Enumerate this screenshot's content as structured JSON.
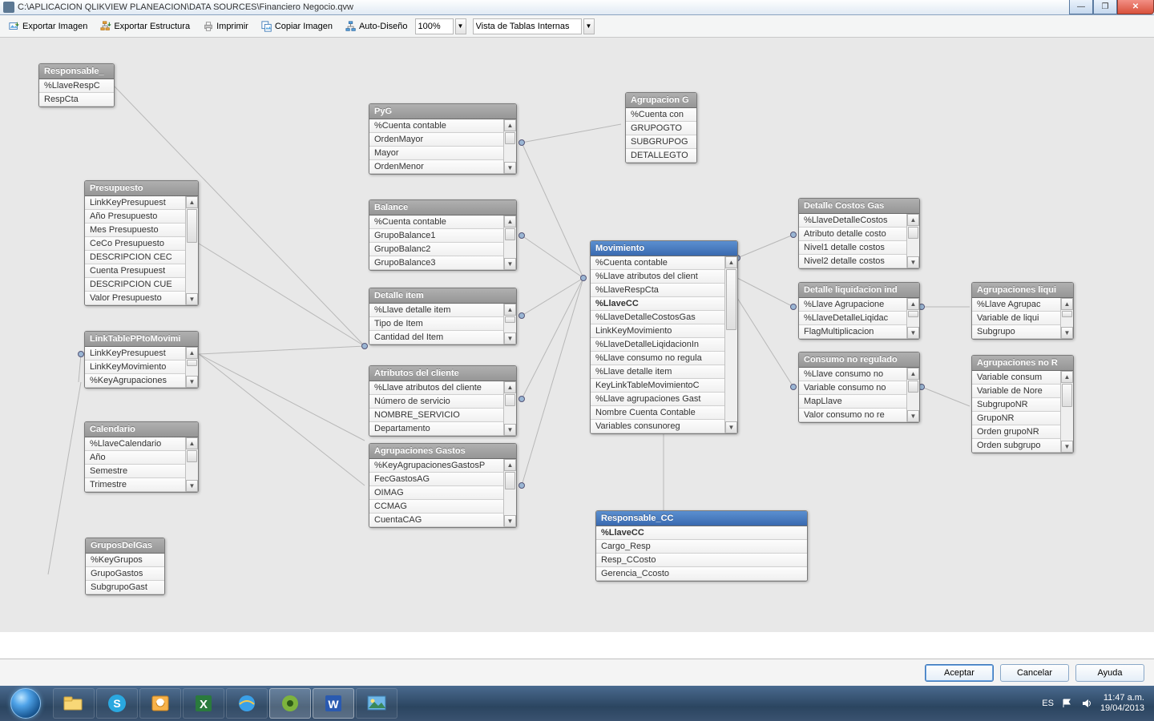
{
  "title": "C:\\APLICACION QLIKVIEW PLANEACION\\DATA SOURCES\\Financiero Negocio.qvw",
  "window_buttons": {
    "min": "—",
    "max": "❐",
    "close": "✕"
  },
  "toolbar": {
    "export_image": "Exportar Imagen",
    "export_struct": "Exportar Estructura",
    "print": "Imprimir",
    "copy_image": "Copiar Imagen",
    "auto_design": "Auto-Diseño",
    "zoom": "100%",
    "view_tables": "Vista de Tablas Internas"
  },
  "tables": {
    "responsable": {
      "title": "Responsable_",
      "rows": [
        "%LlaveRespC",
        "RespCta"
      ],
      "scroll": false
    },
    "presupuesto": {
      "title": "Presupuesto",
      "rows": [
        "LinkKeyPresupuest",
        "Año Presupuesto",
        "Mes Presupuesto",
        "CeCo Presupuesto",
        "DESCRIPCION CEC",
        "Cuenta Presupuest",
        "DESCRIPCION CUE",
        "Valor Presupuesto"
      ],
      "scroll": true
    },
    "linktable": {
      "title": "LinkTablePPtoMovimi",
      "rows": [
        "LinkKeyPresupuest",
        "LinkKeyMovimiento",
        "%KeyAgrupaciones"
      ],
      "scroll": true
    },
    "calendario": {
      "title": "Calendario",
      "rows": [
        "%LlaveCalendario",
        "Año",
        "Semestre",
        "Trimestre"
      ],
      "scroll": true
    },
    "gruposgas": {
      "title": "GruposDelGas",
      "rows": [
        "%KeyGrupos",
        "GrupoGastos",
        "SubgrupoGast"
      ],
      "scroll": false
    },
    "pyg": {
      "title": "PyG",
      "rows": [
        "%Cuenta contable",
        "OrdenMayor",
        "Mayor",
        "OrdenMenor"
      ],
      "scroll": true
    },
    "balance": {
      "title": "Balance",
      "rows": [
        "%Cuenta contable",
        "GrupoBalance1",
        "GrupoBalanc2",
        "GrupoBalance3"
      ],
      "scroll": true
    },
    "detalleitem": {
      "title": "Detalle item",
      "rows": [
        "%Llave detalle item",
        "Tipo de Item",
        "Cantidad del Item"
      ],
      "scroll": true
    },
    "atributos": {
      "title": "Atributos del cliente",
      "rows": [
        "%Llave atributos del cliente",
        "Número de servicio",
        "NOMBRE_SERVICIO",
        "Departamento"
      ],
      "scroll": true
    },
    "agrupgastos": {
      "title": "Agrupaciones Gastos",
      "rows": [
        "%KeyAgrupacionesGastosP",
        "FecGastosAG",
        "OIMAG",
        "CCMAG",
        "CuentaCAG"
      ],
      "scroll": true
    },
    "agrupaciong": {
      "title": "Agrupacion G",
      "rows": [
        "%Cuenta con",
        "GRUPOGTO",
        "SUBGRUPOG",
        "DETALLEGTO"
      ],
      "scroll": false
    },
    "movimiento": {
      "title": "Movimiento",
      "rows": [
        "%Cuenta contable",
        "%Llave atributos del client",
        "%LlaveRespCta",
        "%LlaveCC",
        "%LlaveDetalleCostosGas",
        "LinkKeyMovimiento",
        "%LlaveDetalleLiqidacionIn",
        "%Llave consumo no regula",
        "%Llave detalle item",
        "KeyLinkTableMovimientoC",
        "%Llave agrupaciones Gast",
        "Nombre Cuenta Contable",
        "Variables consunoreg"
      ],
      "scroll": true,
      "bold": [
        3
      ]
    },
    "responsablecc": {
      "title": "Responsable_CC",
      "rows": [
        "%LlaveCC",
        "Cargo_Resp",
        "Resp_CCosto",
        "Gerencia_Ccosto"
      ],
      "scroll": false,
      "bold": [
        0
      ]
    },
    "detallecostos": {
      "title": "Detalle Costos Gas",
      "rows": [
        "%LlaveDetalleCostos",
        "Atributo detalle costo",
        "Nivel1 detalle costos",
        "Nivel2 detalle costos"
      ],
      "scroll": true
    },
    "detalleliq": {
      "title": "Detalle liquidacion ind",
      "rows": [
        "%Llave Agrupacione",
        "%LlaveDetalleLiqidac",
        "FlagMultiplicacion"
      ],
      "scroll": true
    },
    "consumonr": {
      "title": "Consumo no regulado",
      "rows": [
        "%Llave consumo no",
        "Variable consumo no",
        "MapLlave",
        "Valor consumo no re"
      ],
      "scroll": true
    },
    "agrupliqui": {
      "title": "Agrupaciones liqui",
      "rows": [
        "%Llave Agrupac",
        "Variable de liqui",
        "Subgrupo"
      ],
      "scroll": true
    },
    "agrupnr": {
      "title": "Agrupaciones no R",
      "rows": [
        "Variable consum",
        "Variable de Nore",
        "SubgrupoNR",
        "GrupoNR",
        "Orden grupoNR",
        "Orden subgrupo"
      ],
      "scroll": true
    }
  },
  "footer": {
    "accept": "Aceptar",
    "cancel": "Cancelar",
    "help": "Ayuda"
  },
  "tray": {
    "lang": "ES",
    "time": "11:47 a.m.",
    "date": "19/04/2013"
  }
}
